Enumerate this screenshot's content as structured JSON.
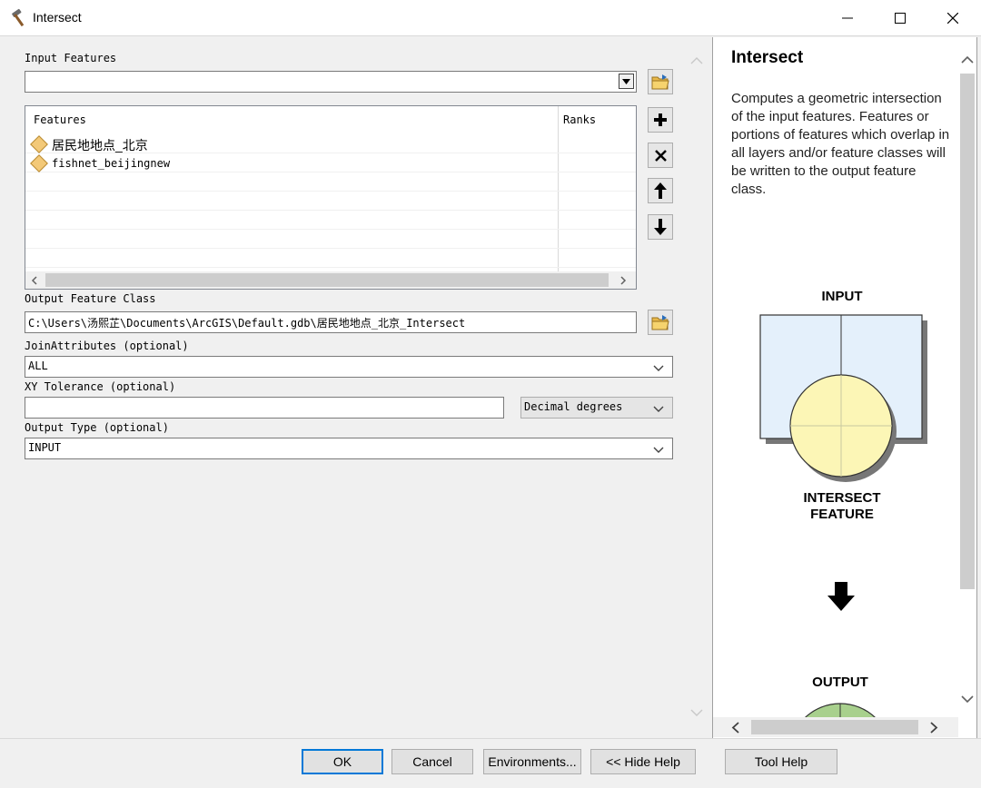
{
  "window": {
    "title": "Intersect",
    "title_icon": "hammer-icon",
    "controls": [
      "minimize-icon",
      "maximize-icon",
      "close-icon"
    ]
  },
  "form": {
    "input_features": {
      "label": "Input Features",
      "value": "",
      "browse_icon": "folder-icon"
    },
    "features_table": {
      "headers": [
        "Features",
        "Ranks"
      ],
      "rows": [
        {
          "name": "居民地地点_北京",
          "rank": "",
          "icon": "feature-layer-icon"
        },
        {
          "name": "fishnet_beijingnew",
          "rank": "",
          "icon": "feature-layer-icon"
        }
      ],
      "empty_rows": 5
    },
    "list_buttons": [
      "add-icon",
      "remove-icon",
      "move-up-icon",
      "move-down-icon"
    ],
    "output_feature_class": {
      "label": "Output Feature Class",
      "value": "C:\\Users\\汤熙芷\\Documents\\ArcGIS\\Default.gdb\\居民地地点_北京_Intersect",
      "browse_icon": "folder-icon"
    },
    "join_attributes": {
      "label": "JoinAttributes (optional)",
      "value": "ALL"
    },
    "xy_tolerance": {
      "label": "XY Tolerance (optional)",
      "value": "",
      "unit": "Decimal degrees"
    },
    "output_type": {
      "label": "Output Type (optional)",
      "value": "INPUT"
    }
  },
  "help": {
    "title": "Intersect",
    "description": "Computes a geometric intersection of the input features. Features or portions of features which overlap in all layers and/or feature classes will be written to the output feature class.",
    "diagram": {
      "input_label": "INPUT",
      "intersect_label_line1": "INTERSECT",
      "intersect_label_line2": "FEATURE",
      "output_label": "OUTPUT"
    }
  },
  "buttons": {
    "ok": "OK",
    "cancel": "Cancel",
    "environments": "Environments...",
    "hide_help": "<< Hide Help",
    "tool_help": "Tool Help"
  },
  "colors": {
    "accent": "#0078d7",
    "polygon_fill": "#e4f0fb",
    "circle_fill": "#fcf6b6",
    "output_fill": "#a8d08d",
    "feature_icon": "#f3c978"
  }
}
